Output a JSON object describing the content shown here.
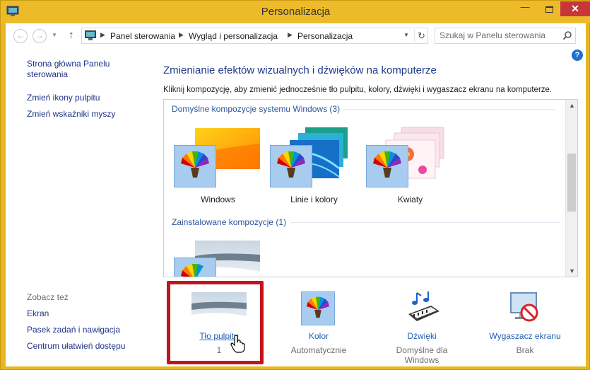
{
  "window": {
    "title": "Personalizacja"
  },
  "address_bar": {
    "breadcrumbs": [
      "Panel sterowania",
      "Wygląd i personalizacja",
      "Personalizacja"
    ]
  },
  "search": {
    "placeholder": "Szukaj w Panelu sterowania"
  },
  "sidebar": {
    "links": [
      "Strona główna Panelu sterowania",
      "Zmień ikony pulpitu",
      "Zmień wskaźniki myszy"
    ],
    "see_also_heading": "Zobacz też",
    "see_also": [
      "Ekran",
      "Pasek zadań i nawigacja",
      "Centrum ułatwień dostępu"
    ]
  },
  "main": {
    "title": "Zmienianie efektów wizualnych i dźwięków na komputerze",
    "description": "Kliknij kompozycję, aby zmienić jednocześnie tło pulpitu, kolory, dźwięki i wygaszacz ekranu na komputerze.",
    "groups": [
      {
        "heading": "Domyślne kompozycje systemu Windows (3)",
        "themes": [
          "Windows",
          "Linie i kolory",
          "Kwiaty"
        ]
      },
      {
        "heading": "Zainstalowane kompozycje (1)",
        "themes": [
          ""
        ]
      }
    ]
  },
  "bottom": [
    {
      "label": "Tło pulpitu",
      "value": "1"
    },
    {
      "label": "Kolor",
      "value": "Automatycznie"
    },
    {
      "label": "Dźwięki",
      "value": "Domyślne dla Windows"
    },
    {
      "label": "Wygaszacz ekranu",
      "value": "Brak"
    }
  ],
  "icons": {
    "app": "control-panel-icon",
    "back": "back-arrow-icon",
    "forward": "forward-arrow-icon",
    "up": "up-arrow-icon",
    "refresh": "refresh-icon",
    "search": "search-icon",
    "help": "help-icon",
    "cursor": "hand-cursor-icon"
  },
  "colors": {
    "frame": "#edbb2a",
    "close_button": "#c7373a",
    "link": "#1e3287",
    "heading": "#1e3a8a",
    "highlight_box": "#c4141b"
  }
}
